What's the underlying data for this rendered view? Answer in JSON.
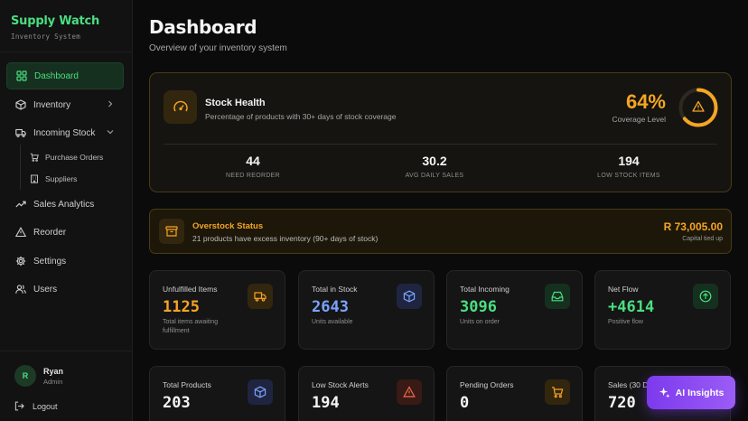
{
  "brand": {
    "name": "Supply Watch",
    "subtitle": "Inventory System"
  },
  "nav": {
    "dashboard": "Dashboard",
    "inventory": "Inventory",
    "incoming_stock": "Incoming Stock",
    "purchase_orders": "Purchase Orders",
    "suppliers": "Suppliers",
    "sales_analytics": "Sales Analytics",
    "reorder": "Reorder",
    "settings": "Settings",
    "users": "Users"
  },
  "user": {
    "initial": "R",
    "name": "Ryan",
    "role": "Admin",
    "logout": "Logout"
  },
  "page": {
    "title": "Dashboard",
    "subtitle": "Overview of your inventory system"
  },
  "stock_health": {
    "title": "Stock Health",
    "description": "Percentage of products with 30+ days of stock coverage",
    "percent": "64%",
    "percent_value": 64,
    "percent_label": "Coverage Level",
    "stats": [
      {
        "value": "44",
        "label": "NEED REORDER"
      },
      {
        "value": "30.2",
        "label": "AVG DAILY SALES"
      },
      {
        "value": "194",
        "label": "LOW STOCK ITEMS"
      }
    ]
  },
  "overstock": {
    "title": "Overstock Status",
    "description": "21 products have excess inventory (90+ days of stock)",
    "amount": "R 73,005.00",
    "amount_label": "Capital tied up"
  },
  "cards": [
    {
      "label": "Unfulfilled Items",
      "value": "1125",
      "note": "Total items awaiting fulfillment",
      "color": "#f5a524",
      "icon": "truck-icon"
    },
    {
      "label": "Total in Stock",
      "value": "2643",
      "note": "Units available",
      "color": "#7aa2ff",
      "icon": "box-icon"
    },
    {
      "label": "Total Incoming",
      "value": "3096",
      "note": "Units on order",
      "color": "#4ade80",
      "icon": "inbox-icon"
    },
    {
      "label": "Net Flow",
      "value": "+4614",
      "note": "Positive flow",
      "color": "#4ade80",
      "icon": "arrow-up-circle-icon"
    },
    {
      "label": "Total Products",
      "value": "203",
      "note": "",
      "color": "#f5f5f5",
      "icon": "box-icon"
    },
    {
      "label": "Low Stock Alerts",
      "value": "194",
      "note": "",
      "color": "#f5f5f5",
      "icon": "alert-triangle-icon"
    },
    {
      "label": "Pending Orders",
      "value": "0",
      "note": "",
      "color": "#f5f5f5",
      "icon": "cart-icon"
    },
    {
      "label": "Sales (30 D",
      "value": "720",
      "note": "",
      "color": "#f5f5f5",
      "icon": "chart-icon"
    }
  ],
  "ai_button": {
    "label": "AI Insights"
  },
  "colors": {
    "accent_green": "#4ade80",
    "accent_amber": "#f5a524",
    "accent_purple": "#7c3aed"
  }
}
